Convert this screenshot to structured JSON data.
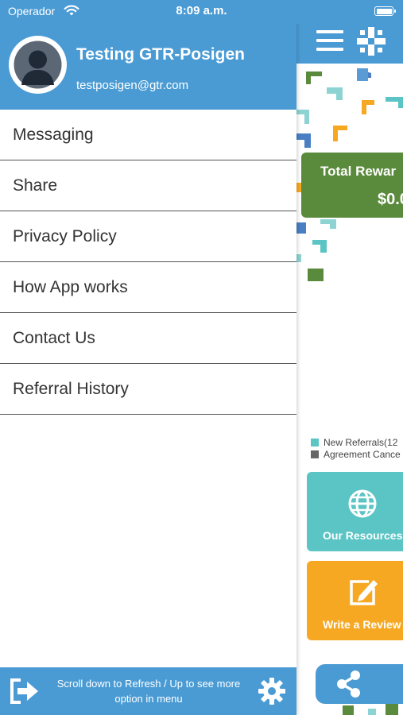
{
  "status_bar": {
    "carrier": "Operador",
    "time": "8:09 a.m."
  },
  "drawer": {
    "user": {
      "name": "Testing GTR-Posigen",
      "email": "testposigen@gtr.com"
    },
    "menu_items": [
      {
        "label": "Messaging"
      },
      {
        "label": "Share"
      },
      {
        "label": "Privacy Policy"
      },
      {
        "label": "How App works"
      },
      {
        "label": "Contact Us"
      },
      {
        "label": "Referral History"
      }
    ],
    "footer": {
      "hint_line1": "Scroll down to Refresh / Up to see more",
      "hint_line2": "option in menu"
    }
  },
  "background_screen": {
    "rewards_card": {
      "title": "Total Rewar",
      "amount": "$0.0"
    },
    "legend": [
      {
        "label": "New Referrals(12",
        "color": "#5bc4c4"
      },
      {
        "label": "Agreement Cance",
        "color": "#666666"
      }
    ],
    "tiles": [
      {
        "label": "Our Resources",
        "icon": "globe-icon",
        "color": "#5bc4c4"
      },
      {
        "label": "Write a Review",
        "icon": "edit-icon",
        "color": "#f7a823"
      }
    ]
  },
  "colors": {
    "primary_blue": "#4a9bd4",
    "rewards_green": "#5a8a3c",
    "teal": "#5bc4c4",
    "orange": "#f7a823"
  }
}
